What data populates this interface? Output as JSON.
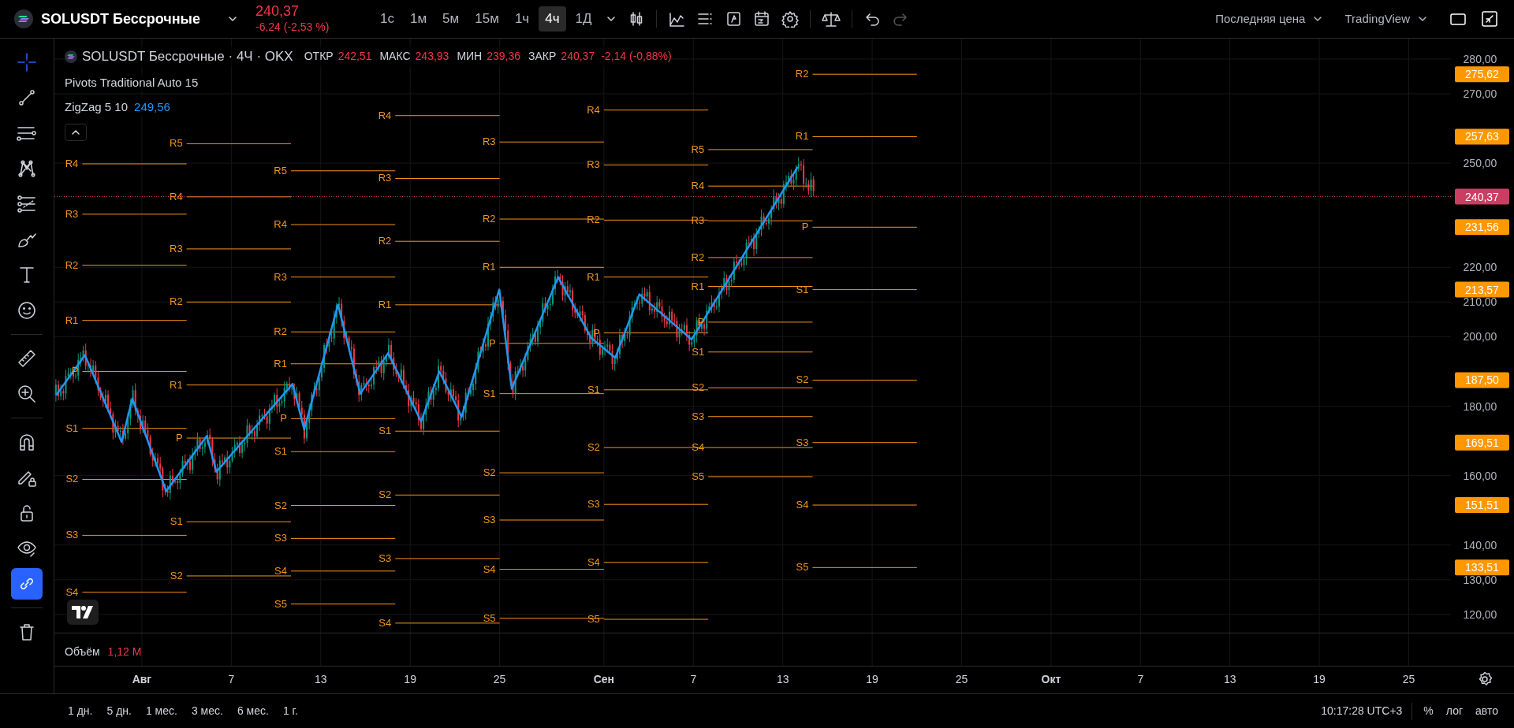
{
  "header": {
    "symbol": "SOLUSDT Бессрочные",
    "price": "240,37",
    "change": "-6,24 (-2,53 %)",
    "intervals": [
      {
        "label": "1с",
        "selected": false
      },
      {
        "label": "1м",
        "selected": false
      },
      {
        "label": "5м",
        "selected": false
      },
      {
        "label": "15м",
        "selected": false
      },
      {
        "label": "1ч",
        "selected": false
      },
      {
        "label": "4ч",
        "selected": true
      },
      {
        "label": "1Д",
        "selected": false
      }
    ],
    "price_source": "Последняя цена",
    "layout": "TradingView"
  },
  "tools": [
    [
      {
        "kind": "crosshair",
        "selected": true,
        "highlighted": false
      },
      {
        "kind": "trend-line",
        "selected": false,
        "highlighted": false
      },
      {
        "kind": "horizontal-lines",
        "selected": false,
        "highlighted": false
      },
      {
        "kind": "pattern",
        "selected": false,
        "highlighted": false
      },
      {
        "kind": "fib",
        "selected": false,
        "highlighted": false
      },
      {
        "kind": "brush",
        "selected": false,
        "highlighted": false
      },
      {
        "kind": "text",
        "selected": false,
        "highlighted": false
      },
      {
        "kind": "smile",
        "selected": false,
        "highlighted": false
      }
    ],
    [
      {
        "kind": "ruler",
        "selected": false,
        "highlighted": false
      },
      {
        "kind": "zoom",
        "selected": false,
        "highlighted": false
      }
    ],
    [
      {
        "kind": "magnet",
        "selected": false,
        "highlighted": false
      },
      {
        "kind": "drawing-lock",
        "selected": false,
        "highlighted": false
      },
      {
        "kind": "lock",
        "selected": false,
        "highlighted": false
      },
      {
        "kind": "eye",
        "selected": false,
        "highlighted": false
      },
      {
        "kind": "link",
        "selected": false,
        "highlighted": true
      }
    ],
    [
      {
        "kind": "trash",
        "selected": false,
        "highlighted": false
      }
    ]
  ],
  "legend": {
    "title": "SOLUSDT Бессрочные · 4Ч · OKX",
    "ohlc": [
      {
        "label": "ОТКР",
        "value": "242,51"
      },
      {
        "label": "МАКС",
        "value": "243,93"
      },
      {
        "label": "МИН",
        "value": "239,36"
      },
      {
        "label": "ЗАКР",
        "value": "240,37"
      }
    ],
    "change": "-2,14 (-0,88%)",
    "indicators": [
      {
        "name": "Pivots Traditional Auto 15"
      },
      {
        "name": "ZigZag 5 10",
        "value": "249,56"
      }
    ]
  },
  "volume": {
    "label": "Объём",
    "value": "1,12 M"
  },
  "price_axis": [
    {
      "text": "280,00",
      "kind": "tick"
    },
    {
      "text": "275,62",
      "kind": "badge"
    },
    {
      "text": "270,00",
      "kind": "tick"
    },
    {
      "text": "257,63",
      "kind": "badge"
    },
    {
      "text": "250,00",
      "kind": "tick"
    },
    {
      "text": "231,56",
      "kind": "badge"
    },
    {
      "text": "220,00",
      "kind": "tick"
    },
    {
      "text": "213,57",
      "kind": "badge"
    },
    {
      "text": "210,00",
      "kind": "tick"
    },
    {
      "text": "200,00",
      "kind": "tick"
    },
    {
      "text": "187,50",
      "kind": "badge"
    },
    {
      "text": "180,00",
      "kind": "tick"
    },
    {
      "text": "169,51",
      "kind": "badge"
    },
    {
      "text": "160,00",
      "kind": "tick"
    },
    {
      "text": "151,51",
      "kind": "badge"
    },
    {
      "text": "140,00",
      "kind": "tick"
    },
    {
      "text": "133,51",
      "kind": "badge"
    },
    {
      "text": "130,00",
      "kind": "tick"
    },
    {
      "text": "120,00",
      "kind": "tick"
    }
  ],
  "last_price": {
    "text": "240,37"
  },
  "time_axis": [
    "Авг",
    "7",
    "13",
    "19",
    "25",
    "Сен",
    "7",
    "13",
    "19",
    "25",
    "Окт",
    "7",
    "13",
    "19",
    "25"
  ],
  "pivots": [
    {
      "levels": [
        "R4",
        "R3",
        "R2",
        "R1",
        "P",
        "S1",
        "S2",
        "S3",
        "S4"
      ]
    },
    {
      "levels": [
        "R5",
        "R4",
        "R3",
        "R2",
        "R1",
        "P",
        "S1",
        "S2"
      ]
    },
    {
      "levels": [
        "R5",
        "R4",
        "R3",
        "R2",
        "R1",
        "P",
        "S1",
        "S2",
        "S3",
        "S4",
        "S5"
      ]
    },
    {
      "levels": [
        "R4",
        "R3",
        "R2",
        "R1",
        "S1",
        "S2",
        "S3",
        "S4"
      ]
    },
    {
      "levels": [
        "R3",
        "R2",
        "R1",
        "P",
        "S1",
        "S2",
        "S3",
        "S4",
        "S5"
      ]
    },
    {
      "levels": [
        "R4",
        "R3",
        "R2",
        "R1",
        "P",
        "S1",
        "S2",
        "S3",
        "S4",
        "S5"
      ]
    },
    {
      "levels": [
        "R5",
        "R4",
        "R3",
        "R2",
        "R1",
        "P",
        "S1",
        "S2",
        "S3",
        "S4",
        "S5"
      ]
    },
    {
      "levels": [
        "R2",
        "R1",
        "P",
        "S1",
        "S2",
        "S3",
        "S4",
        "S5"
      ]
    }
  ],
  "bottom_bar": {
    "ranges": [
      "1 дн.",
      "5 дн.",
      "1 мес.",
      "3 мес.",
      "6 мес.",
      "1 г."
    ],
    "time": "10:17:28 UTC+3",
    "scale_buttons": [
      "%",
      "лог",
      "авто"
    ]
  }
}
